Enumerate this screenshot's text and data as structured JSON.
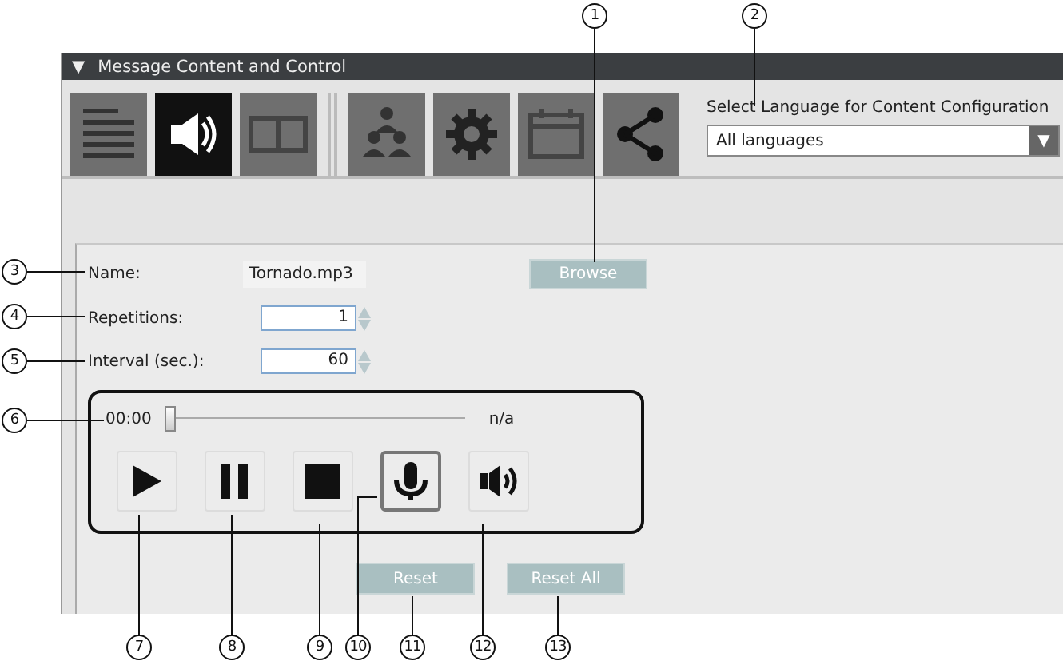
{
  "panel": {
    "title": "Message Content and Control",
    "collapse_glyph": "▼"
  },
  "tab_groups": [
    [
      {
        "kind": "text",
        "selected": false
      },
      {
        "kind": "audio",
        "selected": true
      },
      {
        "kind": "video",
        "selected": false
      }
    ],
    [
      {
        "kind": "recipients",
        "selected": false
      },
      {
        "kind": "settings",
        "selected": false
      },
      {
        "kind": "schedule",
        "selected": false
      },
      {
        "kind": "share",
        "selected": false
      }
    ]
  ],
  "language": {
    "label": "Select Language for Content Configuration",
    "value": "All languages",
    "arrow_glyph": "▼"
  },
  "form": {
    "name_label": "Name:",
    "name_value": "Tornado.mp3",
    "browse": "Browse",
    "repetitions_label": "Repetitions:",
    "repetitions_value": "1",
    "interval_label": "Interval (sec.):",
    "interval_value": "60"
  },
  "player": {
    "time": "00:00",
    "duration": "n/a",
    "level": 0,
    "buttons": [
      {
        "kind": "play",
        "selected": false
      },
      {
        "kind": "pause",
        "selected": false
      },
      {
        "kind": "stop",
        "selected": false
      },
      {
        "kind": "record",
        "selected": true
      },
      {
        "kind": "speaker",
        "selected": false
      }
    ]
  },
  "actions": [
    "Reset",
    "Reset All"
  ],
  "callouts": [
    "1",
    "2",
    "3",
    "4",
    "5",
    "6",
    "7",
    "8",
    "9",
    "10",
    "11",
    "12",
    "13"
  ]
}
